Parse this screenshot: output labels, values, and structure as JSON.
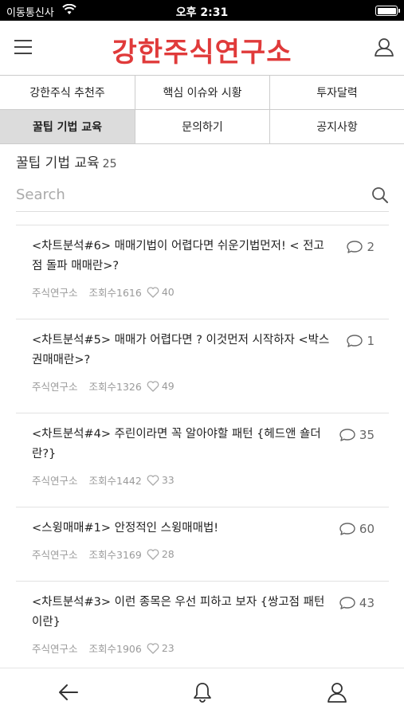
{
  "status_bar": {
    "carrier": "이동통신사",
    "time": "오후 2:31",
    "battery_level": 1.0
  },
  "header": {
    "brand": "강한주식연구소",
    "menu_icon": "hamburger-menu-icon",
    "user_icon": "user-icon"
  },
  "tabs": [
    {
      "label": "강한주식 추천주",
      "active": false
    },
    {
      "label": "핵심 이슈와 시황",
      "active": false
    },
    {
      "label": "투자달력",
      "active": false
    },
    {
      "label": "꿀팁 기법 교육",
      "active": true
    },
    {
      "label": "문의하기",
      "active": false
    },
    {
      "label": "공지사항",
      "active": false
    }
  ],
  "section": {
    "title": "꿀팁 기법 교육",
    "count": "25"
  },
  "search": {
    "placeholder": "Search",
    "value": ""
  },
  "posts": [
    {
      "title": "<차트분석#6> 매매기법이 어렵다면 쉬운기법먼저! < 전고점 돌파 매매란>?",
      "author": "주식연구소",
      "views": "조회수1616",
      "likes": "40",
      "comments": "2"
    },
    {
      "title": "<차트분석#5> 매매가 어렵다면 ? 이것먼저 시작하자 <박스권매매란>?",
      "author": "주식연구소",
      "views": "조회수1326",
      "likes": "49",
      "comments": "1"
    },
    {
      "title": "<차트분석#4> 주린이라면 꼭 알아야할 패턴 {헤드앤 숄더란?}",
      "author": "주식연구소",
      "views": "조회수1442",
      "likes": "33",
      "comments": "35"
    },
    {
      "title": "<스윙매매#1> 안정적인 스윙매매법!",
      "author": "주식연구소",
      "views": "조회수3169",
      "likes": "28",
      "comments": "60"
    },
    {
      "title": "<차트분석#3> 이런 종목은 우선 피하고 보자 {쌍고점 패턴이란}",
      "author": "주식연구소",
      "views": "조회수1906",
      "likes": "23",
      "comments": "43"
    }
  ],
  "bottom_nav": {
    "items": [
      "back-arrow-icon",
      "bell-icon",
      "user-icon"
    ]
  },
  "colors": {
    "brand": "#e03a3a",
    "active_tab_bg": "#dcdcdc",
    "meta_text": "#9a9a9a"
  }
}
